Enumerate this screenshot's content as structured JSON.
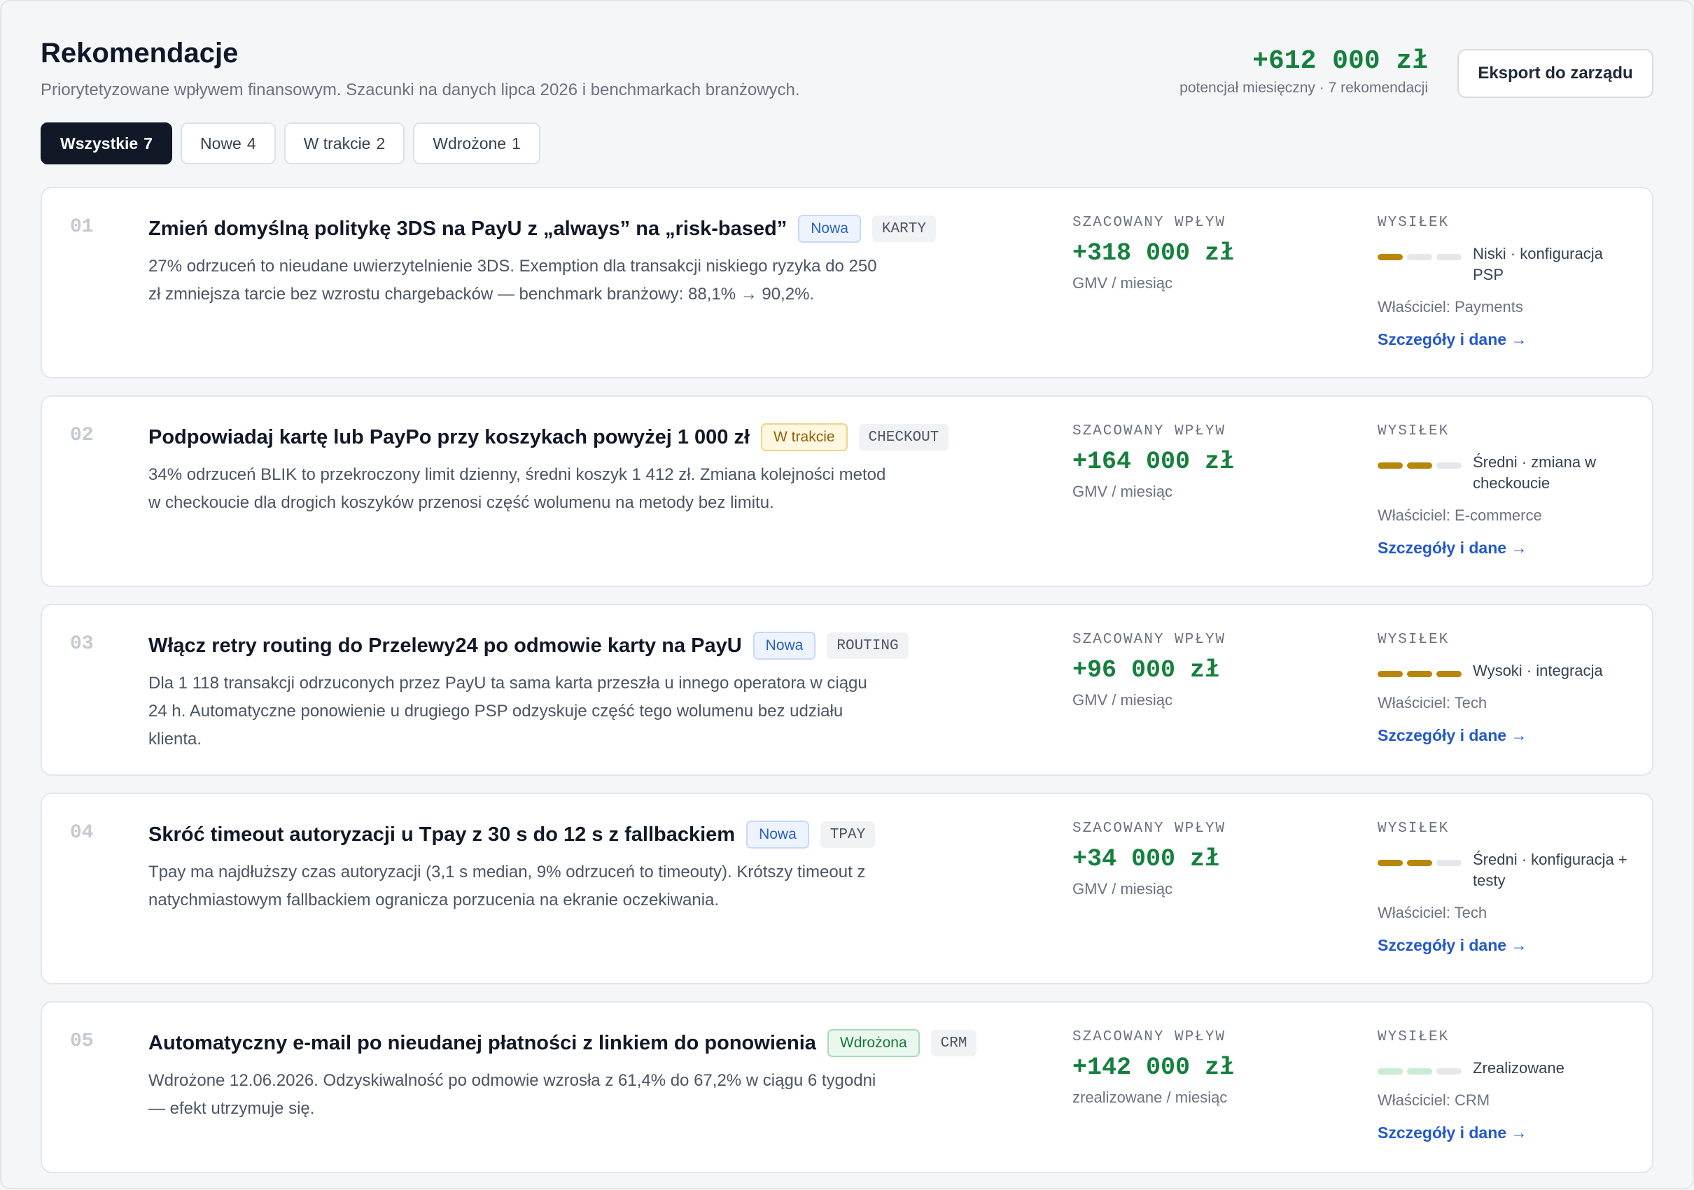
{
  "header": {
    "title": "Rekomendacje",
    "subtitle": "Priorytetyzowane wpływem finansowym. Szacunki na danych lipca 2026 i benchmarkach branżowych.",
    "total_potential": "+612 000 zł",
    "total_caption": "potencjał miesięczny · 7 rekomendacji",
    "export_label": "Eksport do zarządu"
  },
  "tabs": [
    {
      "label": "Wszystkie",
      "count": "7",
      "active": true
    },
    {
      "label": "Nowe",
      "count": "4",
      "active": false
    },
    {
      "label": "W trakcie",
      "count": "2",
      "active": false
    },
    {
      "label": "Wdrożone",
      "count": "1",
      "active": false
    }
  ],
  "labels": {
    "impact": "SZACOWANY WPŁYW",
    "effort": "WYSIŁEK",
    "details": "Szczegóły i dane →"
  },
  "colors": {
    "accent_green": "#15803d",
    "effort_bar": "#b8860b",
    "link_blue": "#2459c9"
  },
  "recommendations": [
    {
      "num": "01",
      "title": "Zmień domyślną politykę 3DS na PayU z „always” na „risk-based”",
      "status": "Nowa",
      "status_class": "nowa",
      "tag": "KARTY",
      "description": "27% odrzuceń to nieudane uwierzytelnienie 3DS. Exemption dla transakcji niskiego ryzyka do 250 zł zmniejsza tarcie bez wzrostu chargebacków — benchmark branżowy: 88,1% → 90,2%.",
      "impact": "+318 000 zł",
      "impact_unit": "GMV / miesiąc",
      "effort_level": 1,
      "effort_max": 3,
      "effort_style": "on",
      "effort_text": "Niski · konfiguracja PSP",
      "owner": "Właściciel: Payments"
    },
    {
      "num": "02",
      "title": "Podpowiadaj kartę lub PayPo przy koszykach powyżej 1 000 zł",
      "status": "W trakcie",
      "status_class": "trakcie",
      "tag": "CHECKOUT",
      "description": "34% odrzuceń BLIK to przekroczony limit dzienny, średni koszyk 1 412 zł. Zmiana kolejności metod w checkoucie dla drogich koszyków przenosi część wolumenu na metody bez limitu.",
      "impact": "+164 000 zł",
      "impact_unit": "GMV / miesiąc",
      "effort_level": 2,
      "effort_max": 3,
      "effort_style": "on",
      "effort_text": "Średni · zmiana w checkoucie",
      "owner": "Właściciel: E-commerce"
    },
    {
      "num": "03",
      "title": "Włącz retry routing do Przelewy24 po odmowie karty na PayU",
      "status": "Nowa",
      "status_class": "nowa",
      "tag": "ROUTING",
      "description": "Dla 1 118 transakcji odrzuconych przez PayU ta sama karta przeszła u innego operatora w ciągu 24 h. Automatyczne ponowienie u drugiego PSP odzyskuje część tego wolumenu bez udziału klienta.",
      "impact": "+96 000 zł",
      "impact_unit": "GMV / miesiąc",
      "effort_level": 3,
      "effort_max": 3,
      "effort_style": "on",
      "effort_text": "Wysoki · integracja",
      "owner": "Właściciel: Tech"
    },
    {
      "num": "04",
      "title": "Skróć timeout autoryzacji u Tpay z 30 s do 12 s z fallbackiem",
      "status": "Nowa",
      "status_class": "nowa",
      "tag": "TPAY",
      "description": "Tpay ma najdłuższy czas autoryzacji (3,1 s median, 9% odrzuceń to timeouty). Krótszy timeout z natychmiastowym fallbackiem ogranicza porzucenia na ekranie oczekiwania.",
      "impact": "+34 000 zł",
      "impact_unit": "GMV / miesiąc",
      "effort_level": 2,
      "effort_max": 3,
      "effort_style": "on",
      "effort_text": "Średni · konfiguracja + testy",
      "owner": "Właściciel: Tech"
    },
    {
      "num": "05",
      "title": "Automatyczny e-mail po nieudanej płatności z linkiem do ponowienia",
      "status": "Wdrożona",
      "status_class": "wdrozona",
      "tag": "CRM",
      "description": "Wdrożone 12.06.2026. Odzyskiwalność po odmowie wzrosła z 61,4% do 67,2% w ciągu 6 tygodni — efekt utrzymuje się.",
      "impact": "+142 000 zł",
      "impact_unit": "zrealizowane / miesiąc",
      "effort_level": 2,
      "effort_max": 3,
      "effort_style": "done",
      "effort_text": "Zrealizowane",
      "owner": "Właściciel: CRM"
    }
  ]
}
